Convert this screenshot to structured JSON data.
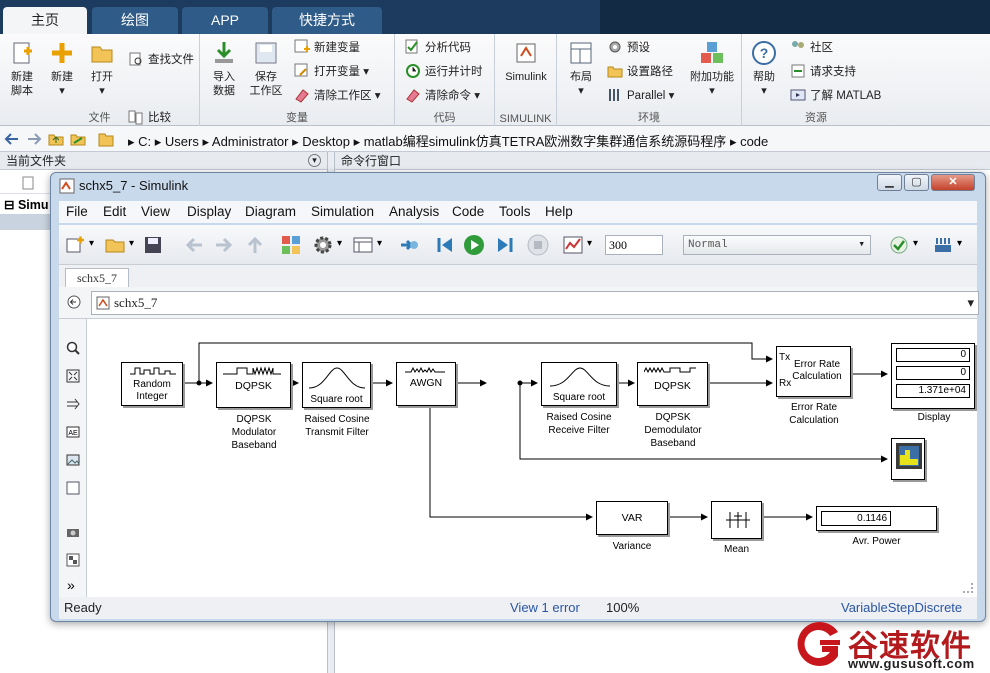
{
  "matlab_tabs": [
    "主页",
    "绘图",
    "APP",
    "快捷方式"
  ],
  "ribbon": {
    "file_group": "文件",
    "new_script": "新建\n脚本",
    "new": "新建",
    "open": "打开",
    "find_files": "查找文件",
    "compare": "比较",
    "variable_group": "变量",
    "import_data": "导入\n数据",
    "save_workspace": "保存\n工作区",
    "new_variable": "新建变量",
    "open_variable": "打开变量",
    "clear_workspace": "清除工作区",
    "code_group": "代码",
    "analyze_code": "分析代码",
    "run_time": "运行并计时",
    "clear_commands": "清除命令",
    "simulink_group": "SIMULINK",
    "simulink": "Simulink",
    "env_group": "环境",
    "layout": "布局",
    "preferences": "预设",
    "set_path": "设置路径",
    "parallel": "Parallel",
    "addons": "附加功能",
    "resources_group": "资源",
    "help": "帮助",
    "community": "社区",
    "request_support": "请求支持",
    "learn_matlab": "了解 MATLAB"
  },
  "address_bar": {
    "crumbs": [
      "C:",
      "Users",
      "Administrator",
      "Desktop",
      "matlab编程simulink仿真TETRA欧洲数字集群通信系统源码程序",
      "code"
    ]
  },
  "left_pane": {
    "title": "当前文件夹",
    "item": "Simu"
  },
  "right_pane": {
    "title": "命令行窗口"
  },
  "simulink": {
    "window_title": "schx5_7 - Simulink",
    "menus": [
      "File",
      "Edit",
      "View",
      "Display",
      "Diagram",
      "Simulation",
      "Analysis",
      "Code",
      "Tools",
      "Help"
    ],
    "stop_time": "300",
    "sim_mode": "Normal",
    "tab": "schx5_7",
    "model_path": "schx5_7",
    "status_ready": "Ready",
    "status_center": "View 1 error",
    "status_zoom": "100%",
    "status_solver": "VariableStepDiscrete",
    "blocks": {
      "random_integer": {
        "icon": "Random\nInteger"
      },
      "dqpsk_mod": {
        "icon": "DQPSK",
        "label": "DQPSK\nModulator\nBaseband"
      },
      "rc_tx": {
        "icon": "Square root",
        "label": "Raised Cosine\nTransmit Filter"
      },
      "awgn": {
        "icon": "AWGN"
      },
      "rc_rx": {
        "icon": "Square root",
        "label": "Raised Cosine\nReceive Filter"
      },
      "dqpsk_demod": {
        "icon": "DQPSK",
        "label": "DQPSK\nDemodulator\nBaseband"
      },
      "error_rate": {
        "icon": "Error Rate\nCalculation",
        "tx": "Tx",
        "rx": "Rx",
        "label": "Error Rate\nCalculation"
      },
      "display": {
        "values": [
          "0",
          "0",
          "1.371e+04"
        ],
        "label": "Display"
      },
      "variance": {
        "icon": "VAR",
        "label": "Variance"
      },
      "mean": {
        "label": "Mean"
      },
      "avr_power": {
        "value": "0.1146",
        "label": "Avr. Power"
      }
    }
  },
  "watermark": {
    "brand": "谷速软件",
    "url": "www.gususoft.com"
  }
}
